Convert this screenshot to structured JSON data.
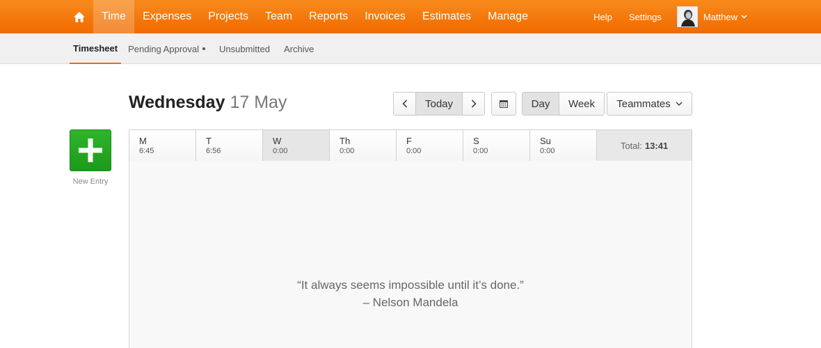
{
  "topnav": {
    "items": [
      {
        "label": "Time",
        "active": true
      },
      {
        "label": "Expenses"
      },
      {
        "label": "Projects"
      },
      {
        "label": "Team"
      },
      {
        "label": "Reports"
      },
      {
        "label": "Invoices"
      },
      {
        "label": "Estimates"
      },
      {
        "label": "Manage"
      }
    ],
    "help": "Help",
    "settings": "Settings",
    "user": "Matthew"
  },
  "subnav": {
    "items": [
      {
        "label": "Timesheet",
        "active": true
      },
      {
        "label": "Pending Approval"
      },
      {
        "label": "Unsubmitted"
      },
      {
        "label": "Archive"
      }
    ]
  },
  "header": {
    "day": "Wednesday",
    "date": "17 May",
    "today": "Today",
    "view_day": "Day",
    "view_week": "Week",
    "teammates": "Teammates"
  },
  "new_entry": {
    "label": "New Entry"
  },
  "week": {
    "days": [
      {
        "name": "M",
        "time": "6:45"
      },
      {
        "name": "T",
        "time": "6:56"
      },
      {
        "name": "W",
        "time": "0:00",
        "selected": true
      },
      {
        "name": "Th",
        "time": "0:00"
      },
      {
        "name": "F",
        "time": "0:00"
      },
      {
        "name": "S",
        "time": "0:00"
      },
      {
        "name": "Su",
        "time": "0:00"
      }
    ],
    "total_label": "Total:",
    "total_value": "13:41"
  },
  "quote": {
    "text": "“It always seems impossible until it’s done.”",
    "author": "– Nelson Mandela"
  },
  "colors": {
    "brand": "#f06a00",
    "new_entry": "#1c9a1a"
  }
}
